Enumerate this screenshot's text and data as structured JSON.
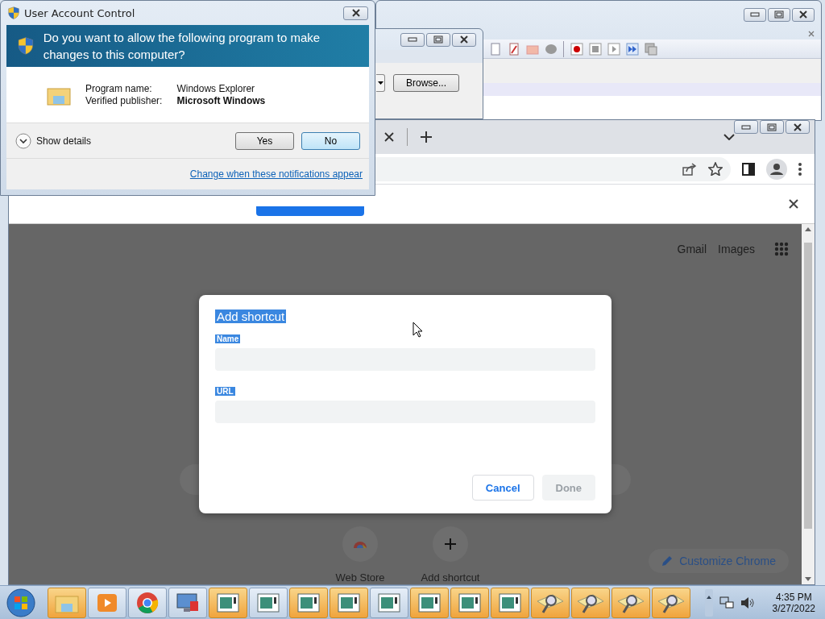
{
  "uac": {
    "title": "User Account Control",
    "question": "Do you want to allow the following program to make changes to this computer?",
    "fields": [
      {
        "label": "Program name:",
        "value": "Windows Explorer",
        "bold": false
      },
      {
        "label": "Verified publisher:",
        "value": "Microsoft Windows",
        "bold": true
      }
    ],
    "details_toggle": {
      "label": "Show details",
      "expanded": false
    },
    "buttons": [
      {
        "label": "Yes",
        "default": false
      },
      {
        "label": "No",
        "default": true
      }
    ],
    "link": "Change when these notifications appear"
  },
  "file_dialog": {
    "button": "Browse..."
  },
  "browser": {
    "header_links": [
      "Gmail",
      "Images"
    ],
    "shortcuts": [
      {
        "label": "Web Store",
        "kind": "webstore"
      },
      {
        "label": "Add shortcut",
        "kind": "add"
      }
    ],
    "customize": "Customize Chrome",
    "dialog": {
      "title": "Add shortcut",
      "text_selected": true,
      "fields": [
        {
          "label": "Name"
        },
        {
          "label": "URL"
        }
      ],
      "buttons": [
        {
          "label": "Cancel",
          "disabled": false
        },
        {
          "label": "Done",
          "disabled": true
        }
      ]
    }
  },
  "taskbar": {
    "items": [
      {
        "kind": "explorer",
        "flashing": true
      },
      {
        "kind": "media",
        "flashing": false
      },
      {
        "kind": "chrome",
        "flashing": false
      },
      {
        "kind": "monitor",
        "flashing": false
      },
      {
        "kind": "window",
        "flashing": true
      },
      {
        "kind": "window",
        "flashing": false
      },
      {
        "kind": "window",
        "flashing": true
      },
      {
        "kind": "window",
        "flashing": true
      },
      {
        "kind": "window",
        "flashing": false
      },
      {
        "kind": "window",
        "flashing": true
      },
      {
        "kind": "window",
        "flashing": true
      },
      {
        "kind": "window",
        "flashing": true
      },
      {
        "kind": "search",
        "flashing": true
      },
      {
        "kind": "search",
        "flashing": true
      },
      {
        "kind": "search",
        "flashing": true
      },
      {
        "kind": "search",
        "flashing": true
      }
    ],
    "clock": {
      "time": "4:35 PM",
      "date": "3/27/2022"
    }
  }
}
